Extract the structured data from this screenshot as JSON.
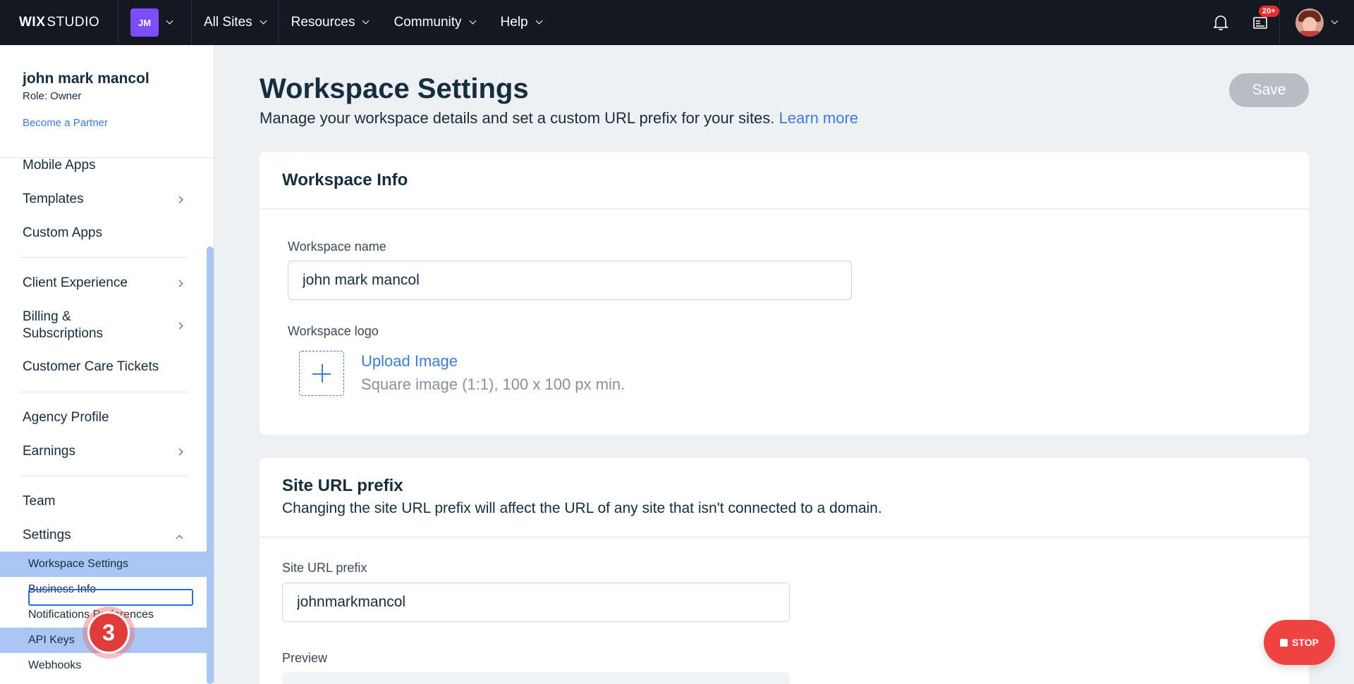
{
  "topbar": {
    "brand_bold": "WIX",
    "brand_light": "STUDIO",
    "workspace_initials": "JM",
    "nav": [
      "All Sites",
      "Resources",
      "Community",
      "Help"
    ],
    "notifications_badge": "20+"
  },
  "sidebar": {
    "account_name": "john mark mancol",
    "role": "Role: Owner",
    "partner_link": "Become a Partner",
    "items": {
      "mobile_apps": "Mobile Apps",
      "templates": "Templates",
      "custom_apps": "Custom Apps",
      "client_experience": "Client Experience",
      "billing_line1": "Billing &",
      "billing_line2": "Subscriptions",
      "customer_care": "Customer Care Tickets",
      "agency_profile": "Agency Profile",
      "earnings": "Earnings",
      "team": "Team",
      "settings": "Settings"
    },
    "settings_sub": {
      "workspace_settings": "Workspace Settings",
      "business_info": "Business Info",
      "notifications": "Notifications Preferences",
      "api_keys": "API Keys",
      "webhooks": "Webhooks"
    },
    "step_marker": "3"
  },
  "main": {
    "title": "Workspace Settings",
    "subtitle": "Manage your workspace details and set a custom URL prefix for your sites.",
    "learn_more": "Learn more",
    "save_label": "Save",
    "workspace_info": {
      "title": "Workspace Info",
      "name_label": "Workspace name",
      "name_value": "john mark mancol",
      "logo_label": "Workspace logo",
      "upload_label": "Upload Image",
      "upload_hint": "Square image (1:1), 100 x 100 px min."
    },
    "url_prefix": {
      "title": "Site URL prefix",
      "description": "Changing the site URL prefix will affect the URL of any site that isn't connected to a domain.",
      "field_label": "Site URL prefix",
      "field_value": "johnmarkmancol",
      "preview_label": "Preview"
    }
  },
  "stop_label": "STOP"
}
